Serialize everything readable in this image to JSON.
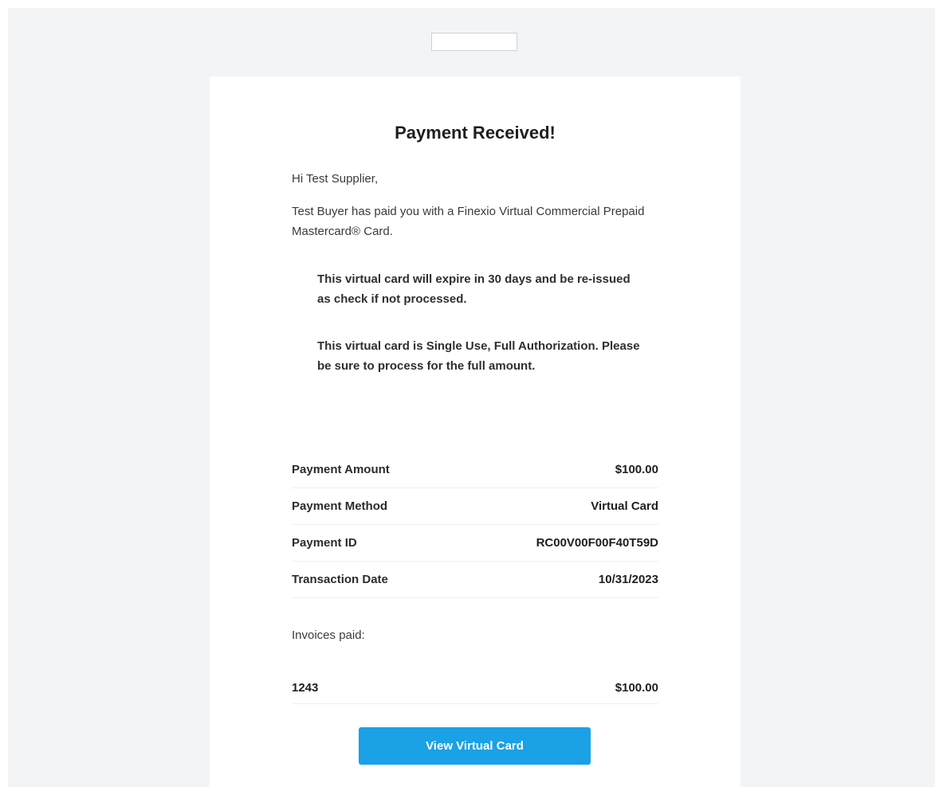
{
  "colors": {
    "page_background": "#f3f4f6",
    "card_background": "#ffffff",
    "button_background": "#1aa1e6",
    "button_text": "#ffffff"
  },
  "email": {
    "title": "Payment Received!",
    "greeting": "Hi Test Supplier,",
    "intro": "Test Buyer has paid you with a Finexio Virtual Commercial Prepaid Mastercard® Card.",
    "notices": [
      "This virtual card will expire in 30 days and be re-issued as check if not processed.",
      "This virtual card is Single Use, Full Authorization. Please be sure to process for the full amount."
    ],
    "details": [
      {
        "label": "Payment Amount",
        "value": "$100.00"
      },
      {
        "label": "Payment Method",
        "value": "Virtual Card"
      },
      {
        "label": "Payment ID",
        "value": "RC00V00F00F40T59D"
      },
      {
        "label": "Transaction Date",
        "value": "10/31/2023"
      }
    ],
    "invoices_label": "Invoices paid:",
    "invoices": [
      {
        "number": "1243",
        "amount": "$100.00"
      }
    ],
    "cta_label": "View Virtual Card"
  }
}
